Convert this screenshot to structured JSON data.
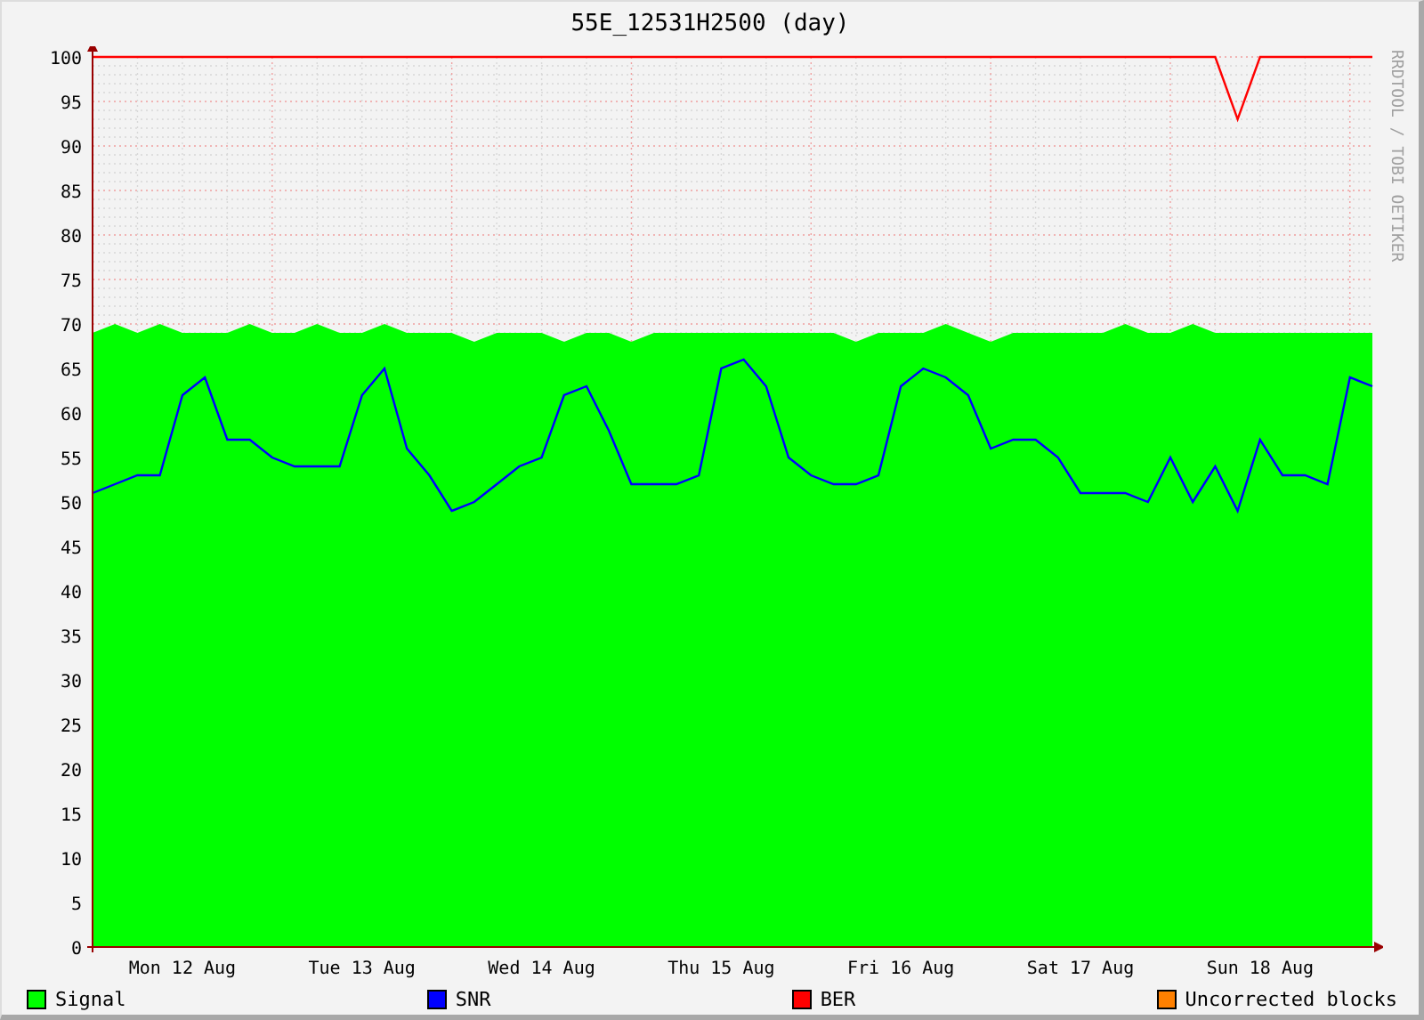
{
  "title": "55E_12531H2500 (day)",
  "side_text": "RRDTOOL / TOBI OETIKER",
  "chart_data": {
    "type": "area",
    "grid": true,
    "ylim": [
      0,
      100
    ],
    "categories": [
      null,
      null,
      null,
      null,
      "Mon 12 Aug",
      null,
      null,
      null,
      null,
      null,
      null,
      null,
      "Tue 13 Aug",
      null,
      null,
      null,
      null,
      null,
      null,
      null,
      "Wed 14 Aug",
      null,
      null,
      null,
      null,
      null,
      null,
      null,
      "Thu 15 Aug",
      null,
      null,
      null,
      null,
      null,
      null,
      null,
      "Fri 16 Aug",
      null,
      null,
      null,
      null,
      null,
      null,
      null,
      "Sat 17 Aug",
      null,
      null,
      null,
      null,
      null,
      null,
      null,
      "Sun 18 Aug",
      null,
      null,
      null,
      null,
      null
    ],
    "yticks": [
      0,
      5,
      10,
      15,
      20,
      25,
      30,
      35,
      40,
      45,
      50,
      55,
      60,
      65,
      70,
      75,
      80,
      85,
      90,
      95,
      100
    ],
    "series": [
      {
        "name": "Signal",
        "type": "area",
        "color": "#00ff00",
        "values": [
          69,
          70,
          69,
          70,
          69,
          69,
          69,
          70,
          69,
          69,
          70,
          69,
          69,
          70,
          69,
          69,
          69,
          68,
          69,
          69,
          69,
          68,
          69,
          69,
          68,
          69,
          69,
          69,
          69,
          69,
          69,
          69,
          69,
          69,
          68,
          69,
          69,
          69,
          70,
          69,
          68,
          69,
          69,
          69,
          69,
          69,
          70,
          69,
          69,
          70,
          69,
          69,
          69,
          69,
          69,
          69,
          69,
          69
        ]
      },
      {
        "name": "SNR",
        "type": "line",
        "color": "#0000ff",
        "values": [
          51,
          52,
          53,
          53,
          62,
          64,
          57,
          57,
          55,
          54,
          54,
          54,
          62,
          65,
          56,
          53,
          49,
          50,
          52,
          54,
          55,
          62,
          63,
          58,
          52,
          52,
          52,
          53,
          65,
          66,
          63,
          55,
          53,
          52,
          52,
          53,
          63,
          65,
          64,
          62,
          56,
          57,
          57,
          55,
          51,
          51,
          51,
          50,
          55,
          50,
          54,
          49,
          57,
          53,
          53,
          52,
          64,
          63
        ]
      },
      {
        "name": "BER",
        "type": "line",
        "color": "#ff0000",
        "values": [
          100,
          100,
          100,
          100,
          100,
          100,
          100,
          100,
          100,
          100,
          100,
          100,
          100,
          100,
          100,
          100,
          100,
          100,
          100,
          100,
          100,
          100,
          100,
          100,
          100,
          100,
          100,
          100,
          100,
          100,
          100,
          100,
          100,
          100,
          100,
          100,
          100,
          100,
          100,
          100,
          100,
          100,
          100,
          100,
          100,
          100,
          100,
          100,
          100,
          100,
          100,
          93,
          100,
          100,
          100,
          100,
          100,
          100
        ]
      },
      {
        "name": "Uncorrected blocks",
        "type": "line",
        "color": "#ff8000",
        "values": [
          null,
          null,
          null,
          null,
          null,
          null,
          null,
          null,
          null,
          null,
          null,
          null,
          null,
          null,
          null,
          null,
          null,
          null,
          null,
          null,
          null,
          null,
          null,
          null,
          null,
          null,
          null,
          null,
          null,
          null,
          null,
          null,
          null,
          null,
          null,
          null,
          null,
          null,
          null,
          null,
          null,
          null,
          null,
          null,
          null,
          null,
          null,
          null,
          null,
          null,
          null,
          null,
          null,
          null,
          null,
          null,
          null,
          null
        ]
      }
    ]
  }
}
